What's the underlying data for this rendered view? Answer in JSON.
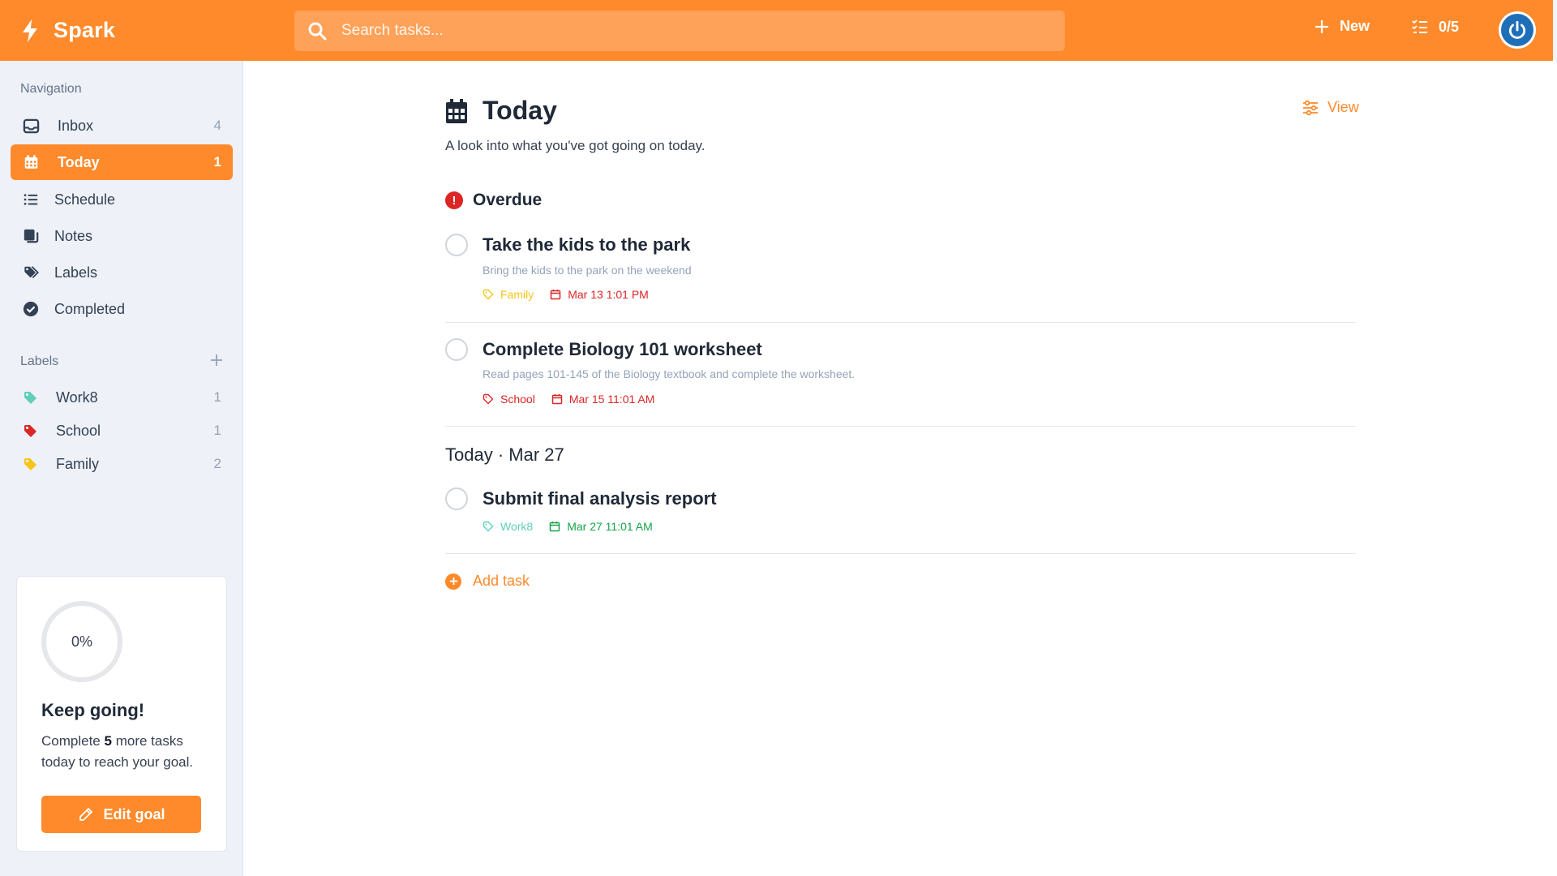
{
  "app": {
    "name": "Spark"
  },
  "colors": {
    "accent": "#ff8a2b",
    "overdue": "#dc2626",
    "work": "#5fcfb8",
    "school": "#dc2626",
    "family": "#f5c518",
    "today_due": "#16a34a"
  },
  "header": {
    "search_placeholder": "Search tasks...",
    "new_label": "New",
    "progress": "0/5",
    "icons": {
      "logo": "bolt-icon",
      "search": "search-icon",
      "new": "plus-icon",
      "progress": "checklist-icon",
      "avatar": "power-icon"
    }
  },
  "sidebar": {
    "navigation_title": "Navigation",
    "nav": [
      {
        "label": "Inbox",
        "count": "4",
        "icon": "inbox-icon"
      },
      {
        "label": "Today",
        "count": "1",
        "icon": "calendar-icon",
        "active": true
      },
      {
        "label": "Schedule",
        "count": "",
        "icon": "list-icon"
      },
      {
        "label": "Notes",
        "count": "",
        "icon": "notes-icon"
      },
      {
        "label": "Labels",
        "count": "",
        "icon": "tags-icon"
      },
      {
        "label": "Completed",
        "count": "",
        "icon": "check-circle-icon"
      }
    ],
    "labels_title": "Labels",
    "labels": [
      {
        "label": "Work8",
        "count": "1",
        "color": "#5fcfb8"
      },
      {
        "label": "School",
        "count": "1",
        "color": "#dc2626"
      },
      {
        "label": "Family",
        "count": "2",
        "color": "#f5c518"
      }
    ],
    "goal": {
      "percent": "0%",
      "progress_fraction": 0,
      "title": "Keep going!",
      "text_pre": "Complete",
      "count": "5",
      "text_post": "more tasks today to reach your goal.",
      "button": "Edit goal"
    }
  },
  "main": {
    "title": "Today",
    "subtitle": "A look into what you've got going on today.",
    "view_label": "View",
    "overdue_title": "Overdue",
    "today_title": "Today · Mar 27",
    "tasks": [
      {
        "title": "Take the kids to the park",
        "description": "Bring the kids to the park on the weekend",
        "label": "Family",
        "due": "Mar 13 1:01 PM"
      },
      {
        "title": "Complete Biology 101 worksheet",
        "description": "Read pages 101-145 of the Biology textbook and complete the worksheet.",
        "label": "School",
        "due": "Mar 15 11:01 AM"
      },
      {
        "title": "Submit final analysis report",
        "description": "",
        "label": "Work8",
        "due": "Mar 27 11:01 AM"
      }
    ],
    "add_task_label": "Add task"
  }
}
